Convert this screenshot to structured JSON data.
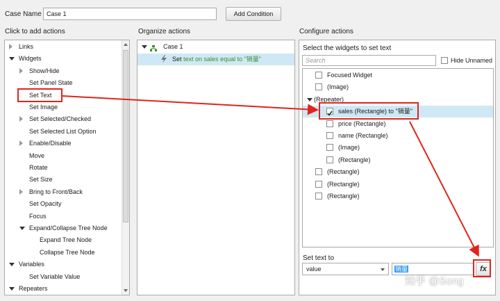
{
  "case": {
    "label": "Case Name",
    "value": "Case 1",
    "add_condition": "Add Condition"
  },
  "left": {
    "title": "Click to add actions",
    "items": [
      {
        "label": "Links",
        "level": 0,
        "arrow": "right"
      },
      {
        "label": "Widgets",
        "level": 0,
        "arrow": "down"
      },
      {
        "label": "Show/Hide",
        "level": 1,
        "arrow": "right"
      },
      {
        "label": "Set Panel State",
        "level": 1,
        "arrow": ""
      },
      {
        "label": "Set Text",
        "level": 1,
        "arrow": ""
      },
      {
        "label": "Set Image",
        "level": 1,
        "arrow": ""
      },
      {
        "label": "Set Selected/Checked",
        "level": 1,
        "arrow": "right"
      },
      {
        "label": "Set Selected List Option",
        "level": 1,
        "arrow": ""
      },
      {
        "label": "Enable/Disable",
        "level": 1,
        "arrow": "right"
      },
      {
        "label": "Move",
        "level": 1,
        "arrow": ""
      },
      {
        "label": "Rotate",
        "level": 1,
        "arrow": ""
      },
      {
        "label": "Set Size",
        "level": 1,
        "arrow": ""
      },
      {
        "label": "Bring to Front/Back",
        "level": 1,
        "arrow": "right"
      },
      {
        "label": "Set Opacity",
        "level": 1,
        "arrow": ""
      },
      {
        "label": "Focus",
        "level": 1,
        "arrow": ""
      },
      {
        "label": "Expand/Collapse Tree Node",
        "level": 1,
        "arrow": "down"
      },
      {
        "label": "Expand Tree Node",
        "level": 2,
        "arrow": ""
      },
      {
        "label": "Collapse Tree Node",
        "level": 2,
        "arrow": ""
      },
      {
        "label": "Variables",
        "level": 0,
        "arrow": "down"
      },
      {
        "label": "Set Variable Value",
        "level": 1,
        "arrow": ""
      },
      {
        "label": "Repeaters",
        "level": 0,
        "arrow": "down"
      }
    ]
  },
  "middle": {
    "title": "Organize actions",
    "case_label": "Case 1",
    "action_prefix": "Set",
    "action_detail": "text on sales equal to \"销量\""
  },
  "right": {
    "title": "Configure actions",
    "select_label": "Select the widgets to set text",
    "search_placeholder": "Search",
    "hide_unnamed": "Hide Unnamed",
    "widgets": [
      {
        "label": "Focused Widget",
        "level": 1,
        "checked": false,
        "selected": false
      },
      {
        "label": "(Image)",
        "level": 1,
        "checked": false,
        "selected": false
      },
      {
        "label": "(Repeater)",
        "level": 0,
        "checked": null,
        "selected": false
      },
      {
        "label": "sales (Rectangle) to \"销量\"",
        "level": 2,
        "checked": true,
        "selected": true
      },
      {
        "label": "price (Rectangle)",
        "level": 2,
        "checked": false,
        "selected": false
      },
      {
        "label": "name (Rectangle)",
        "level": 2,
        "checked": false,
        "selected": false
      },
      {
        "label": "(Image)",
        "level": 2,
        "checked": false,
        "selected": false
      },
      {
        "label": "(Rectangle)",
        "level": 2,
        "checked": false,
        "selected": false
      },
      {
        "label": "(Rectangle)",
        "level": 1,
        "checked": false,
        "selected": false
      },
      {
        "label": "(Rectangle)",
        "level": 1,
        "checked": false,
        "selected": false
      },
      {
        "label": "(Rectangle)",
        "level": 1,
        "checked": false,
        "selected": false
      }
    ],
    "set_text_to": "Set text to",
    "value_select": "value",
    "value_text": "销量",
    "fx": "fx"
  },
  "watermark": "知乎 @Song",
  "colors": {
    "accent_red": "#e0241c",
    "selection": "#cfe8f5",
    "action_green": "#3a8f2a"
  }
}
